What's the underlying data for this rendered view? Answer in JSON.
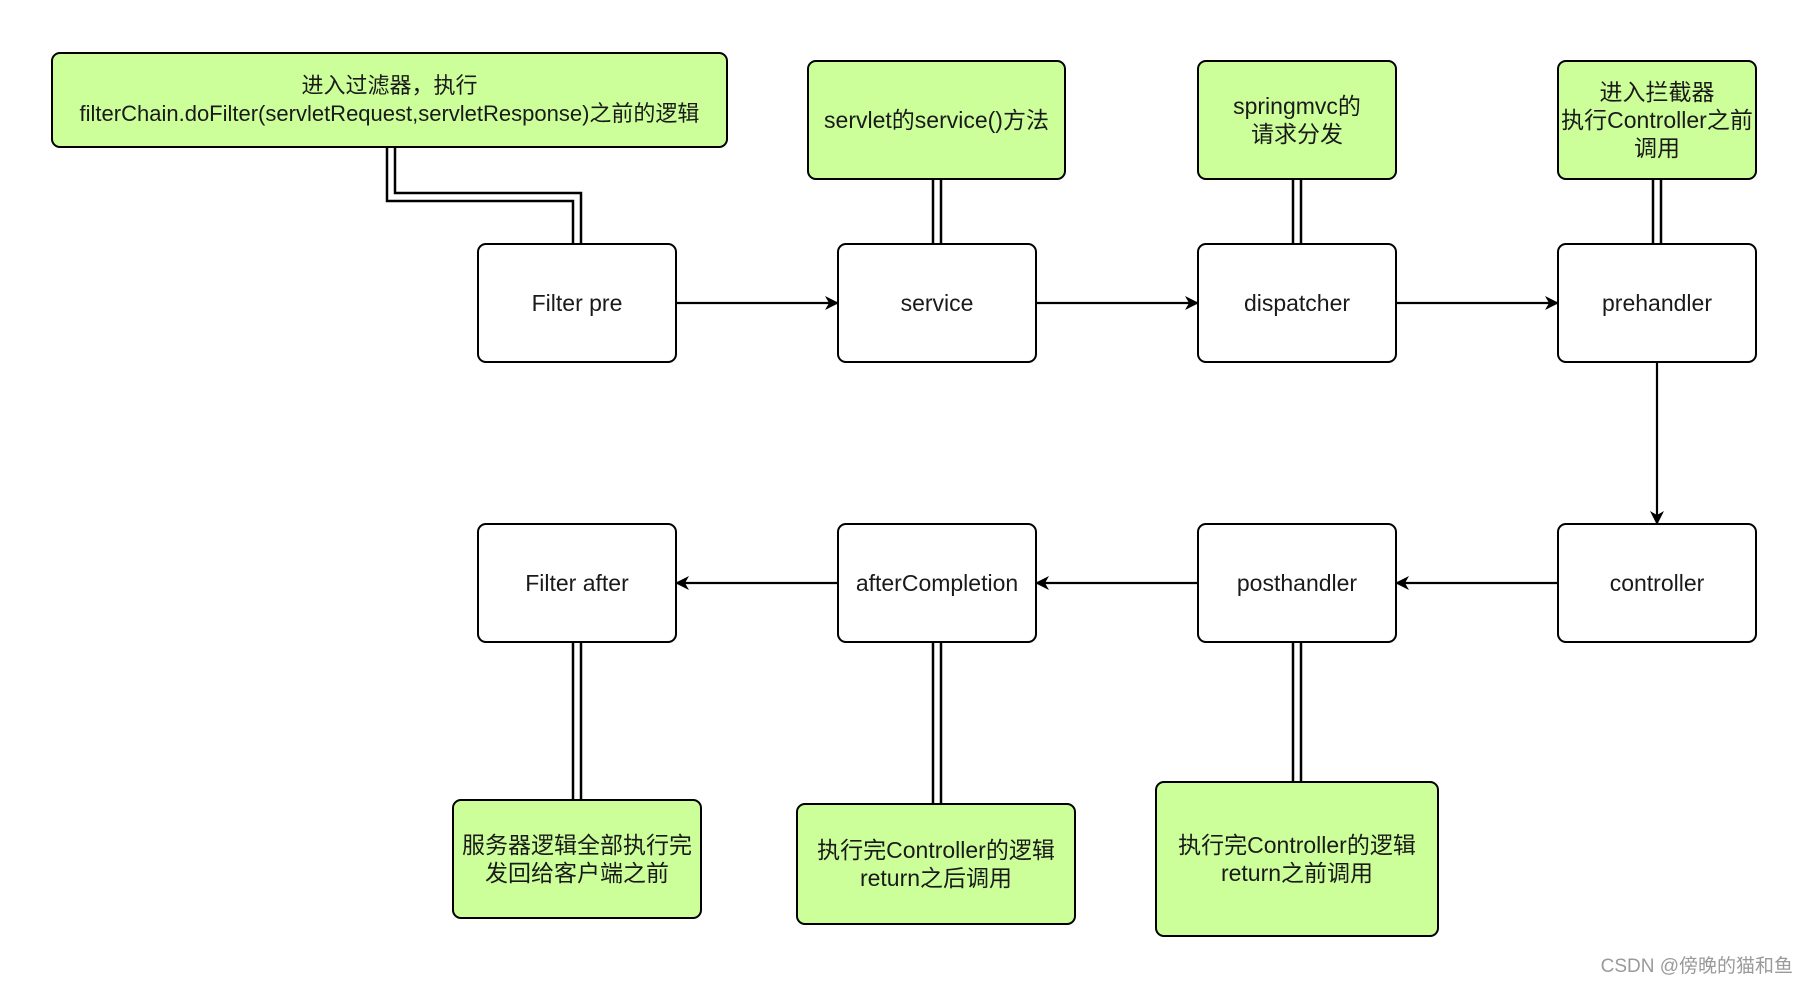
{
  "diagram": {
    "title": "",
    "colors": {
      "note_fill": "#ccff99",
      "node_fill": "#ffffff",
      "stroke": "#000000"
    },
    "nodes": [
      {
        "id": "filter-pre",
        "label": "Filter pre",
        "kind": "step"
      },
      {
        "id": "service",
        "label": "service",
        "kind": "step"
      },
      {
        "id": "dispatcher",
        "label": "dispatcher",
        "kind": "step"
      },
      {
        "id": "prehandler",
        "label": "prehandler",
        "kind": "step"
      },
      {
        "id": "controller",
        "label": "controller",
        "kind": "step"
      },
      {
        "id": "posthandler",
        "label": "posthandler",
        "kind": "step"
      },
      {
        "id": "after-completion",
        "label": "afterCompletion",
        "kind": "step"
      },
      {
        "id": "filter-after",
        "label": "Filter after",
        "kind": "step"
      }
    ],
    "notes": [
      {
        "id": "note-filter-pre",
        "attached_to": "filter-pre",
        "text": "进入过滤器，执行\nfilterChain.doFilter(servletRequest,servletResponse)之前的逻辑"
      },
      {
        "id": "note-service",
        "attached_to": "service",
        "text": "servlet的service()方法"
      },
      {
        "id": "note-dispatcher",
        "attached_to": "dispatcher",
        "text": "springmvc的\n请求分发"
      },
      {
        "id": "note-prehandler",
        "attached_to": "prehandler",
        "text": "进入拦截器\n执行Controller之前\n调用"
      },
      {
        "id": "note-posthandler",
        "attached_to": "posthandler",
        "text": "执行完Controller的逻辑\nreturn之前调用"
      },
      {
        "id": "note-after-completion",
        "attached_to": "after-completion",
        "text": "执行完Controller的逻辑\nreturn之后调用"
      },
      {
        "id": "note-filter-after",
        "attached_to": "filter-after",
        "text": "服务器逻辑全部执行完\n发回给客户端之前"
      }
    ],
    "edges": [
      {
        "from": "filter-pre",
        "to": "service",
        "arrow": true
      },
      {
        "from": "service",
        "to": "dispatcher",
        "arrow": true
      },
      {
        "from": "dispatcher",
        "to": "prehandler",
        "arrow": true
      },
      {
        "from": "prehandler",
        "to": "controller",
        "arrow": true
      },
      {
        "from": "controller",
        "to": "posthandler",
        "arrow": true
      },
      {
        "from": "posthandler",
        "to": "after-completion",
        "arrow": true
      },
      {
        "from": "after-completion",
        "to": "filter-after",
        "arrow": true
      }
    ]
  },
  "watermark": "CSDN @傍晚的猫和鱼"
}
